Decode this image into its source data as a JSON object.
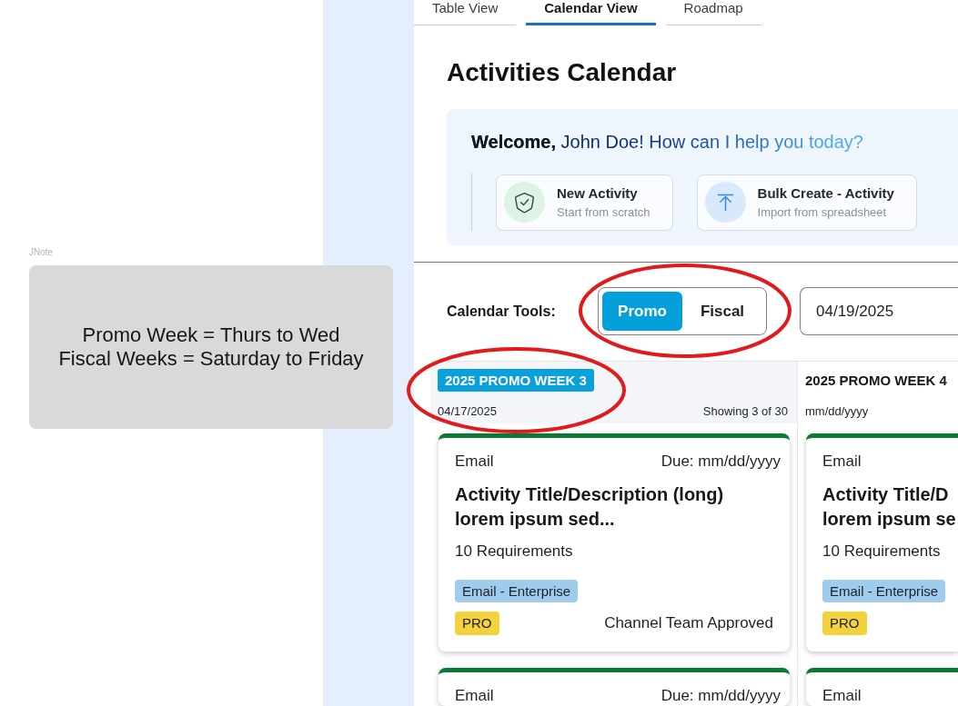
{
  "canvas_note": {
    "label": "JNote",
    "lines": [
      "Promo Week = Thurs to Wed",
      "Fiscal Weeks = Saturday to Friday"
    ]
  },
  "tabs": [
    {
      "label": "Table View",
      "selected": false
    },
    {
      "label": "Calendar View",
      "selected": true
    },
    {
      "label": "Roadmap",
      "selected": false
    }
  ],
  "title": "Activities Calendar",
  "welcome": {
    "message": "**Welcome,** John Doe! How can I help you today?",
    "actions": [
      {
        "kind": "new",
        "title": "New Activity",
        "subtitle": "Start from scratch"
      },
      {
        "kind": "bulk",
        "title": "Bulk Create - Activity",
        "subtitle": "Import from spreadsheet"
      }
    ]
  },
  "calendar_tools": {
    "label": "Calendar Tools:",
    "circled": true,
    "modes": [
      {
        "label": "Promo",
        "selected": true
      },
      {
        "label": "Fiscal",
        "selected": false
      }
    ],
    "date_field": {
      "value": "04/19/2025"
    }
  },
  "weeks": [
    {
      "title": "2025 PROMO WEEK 3",
      "selected": true,
      "circled": true,
      "date": "04/17/2025",
      "count": "Showing 3 of 30",
      "cards": [
        {
          "channel": "Email",
          "due": "Due: mm/dd/yyyy",
          "title": "Activity Title/Description (long) lorem ipsum sed...",
          "requirements": "10 Requirements",
          "segment": "Email - Enterprise",
          "tier": "PRO",
          "status": "Channel Team Approved"
        },
        {
          "channel": "Email",
          "due": "Due: mm/dd/yyyy"
        }
      ]
    },
    {
      "title": "2025 PROMO WEEK 4",
      "selected": false,
      "circled": false,
      "date": "mm/dd/yyyy",
      "cards": [
        {
          "channel": "Email",
          "title": "Activity Title/D lorem ipsum se",
          "requirements": "10 Requirements",
          "segment": "Email - Enterprise",
          "tier": "PRO"
        },
        {
          "channel": "Email"
        }
      ]
    }
  ]
}
